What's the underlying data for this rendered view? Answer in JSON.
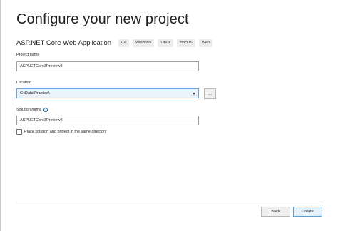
{
  "title": "Configure your new project",
  "template": {
    "name": "ASP.NET Core Web Application",
    "tags": [
      "C#",
      "Windows",
      "Linux",
      "macOS",
      "Web"
    ]
  },
  "project_name": {
    "label": "Project name",
    "value": "ASPNETCore3Preview2"
  },
  "location": {
    "label": "Location",
    "value": "C:\\Data\\Practice\\",
    "browse_label": "..."
  },
  "solution_name": {
    "label": "Solution name",
    "value": "ASPNETCore3Preview2"
  },
  "same_directory": {
    "label": "Place solution and project in the same directory",
    "checked": false
  },
  "buttons": {
    "back": "Back",
    "create": "Create"
  },
  "colors": {
    "primary_border": "#5a9fd6",
    "focused_field": "#eaf3fc"
  },
  "icons": {
    "info": "info-icon",
    "dropdown": "chevron-down-icon"
  }
}
